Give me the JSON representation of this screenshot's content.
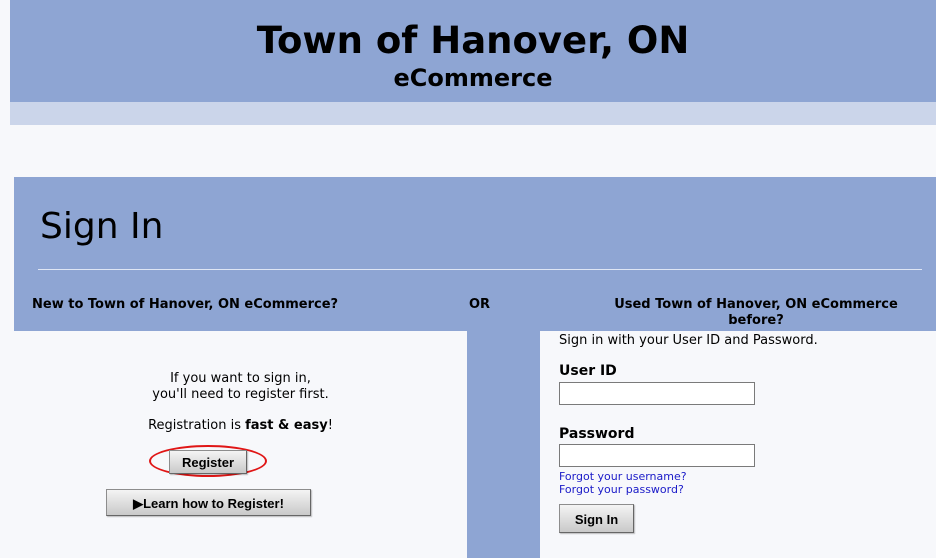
{
  "header": {
    "title": "Town of Hanover, ON",
    "subtitle": "eCommerce"
  },
  "signin": {
    "title": "Sign In",
    "new_heading": "New to Town of Hanover, ON eCommerce?",
    "or_label": "OR",
    "used_heading": "Used Town of Hanover, ON eCommerce before?"
  },
  "register_section": {
    "line1": "If you want to sign in,",
    "line2": "you'll need to register first.",
    "fast_prefix": "Registration is ",
    "fast_bold": "fast & easy",
    "fast_suffix": "!",
    "register_button": "Register",
    "learn_button": "Learn how to Register!"
  },
  "login_section": {
    "instructions": "Sign in with your User ID and Password.",
    "userid_label": "User ID",
    "userid_value": "",
    "password_label": "Password",
    "password_value": "",
    "forgot_username": "Forgot your username?",
    "forgot_password": "Forgot your password?",
    "signin_button": "Sign In"
  },
  "colors": {
    "header_bg": "#8ea5d3",
    "subbar_bg": "#cbd5ea",
    "highlight": "#e01616",
    "link": "#1a1ac8"
  }
}
